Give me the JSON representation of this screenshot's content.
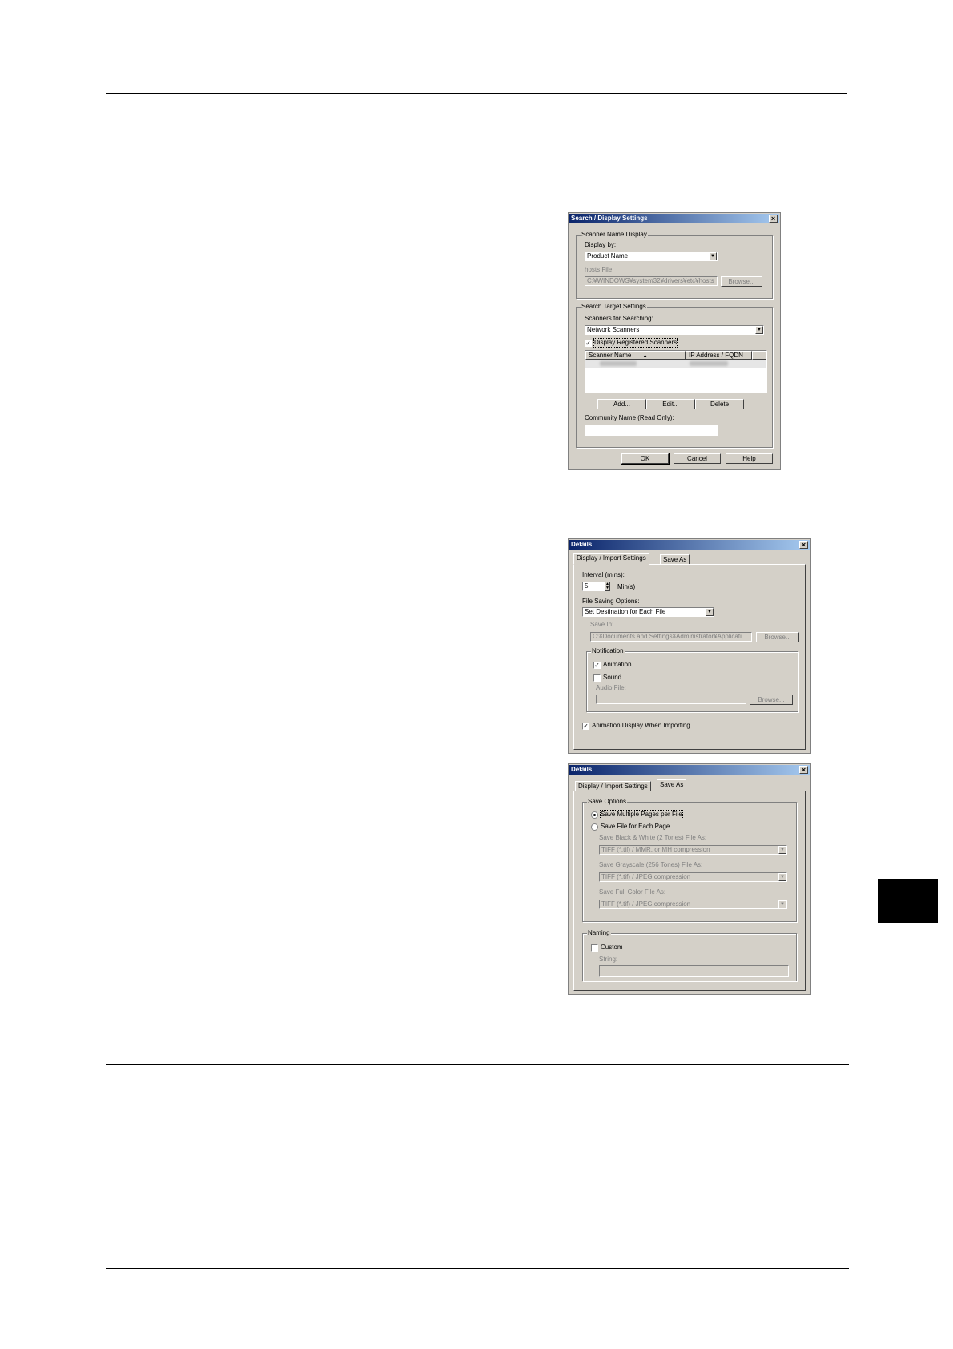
{
  "dialog1": {
    "title": "Search / Display Settings",
    "scanner_name_display": {
      "label": "Scanner Name Display",
      "display_by_label": "Display by:",
      "display_by_value": "Product Name",
      "hosts_file_label": "hosts File:",
      "hosts_file_value": "C:¥WINDOWS¥system32¥drivers¥etc¥hosts",
      "browse_label": "Browse..."
    },
    "search_target": {
      "label": "Search Target Settings",
      "scanners_label": "Scanners for Searching:",
      "scanners_value": "Network Scanners",
      "display_registered_label": "Display Registered Scanners",
      "display_registered_checked": true,
      "columns": [
        "Scanner Name",
        "IP Address / FQDN"
      ],
      "sort_glyph": "▲",
      "add_label": "Add...",
      "edit_label": "Edit...",
      "delete_label": "Delete",
      "community_label": "Community Name (Read Only):",
      "community_value": ""
    },
    "ok_label": "OK",
    "cancel_label": "Cancel",
    "help_label": "Help"
  },
  "dialog2": {
    "title": "Details",
    "tabs": [
      "Display / Import Settings",
      "Save As"
    ],
    "interval_label": "Interval (mins):",
    "interval_value": "5",
    "interval_unit": "Min(s)",
    "file_saving_label": "File Saving Options:",
    "file_saving_value": "Set Destination for Each File",
    "save_in_label": "Save In:",
    "save_in_value": "C:¥Documents and Settings¥Administrator¥Applicati",
    "browse_label": "Browse...",
    "notification_label": "Notification",
    "animation_label": "Animation",
    "animation_checked": true,
    "sound_label": "Sound",
    "sound_checked": false,
    "audio_file_label": "Audio File:",
    "audio_browse_label": "Browse...",
    "anim_display_label": "Animation Display When Importing",
    "anim_display_checked": true
  },
  "dialog3": {
    "title": "Details",
    "tabs": [
      "Display / Import Settings",
      "Save As"
    ],
    "save_options_label": "Save Options",
    "save_multi_label": "Save Multiple Pages per File",
    "save_each_label": "Save File for Each Page",
    "bw_label": "Save Black & White (2 Tones) File As:",
    "bw_value": "TIFF (*.tif) / MMR, or MH compression",
    "gray_label": "Save Grayscale (256 Tones) File As:",
    "gray_value": "TIFF (*.tif) / JPEG compression",
    "color_label": "Save Full Color File As:",
    "color_value": "TIFF (*.tif) / JPEG compression",
    "naming_label": "Naming",
    "custom_label": "Custom",
    "custom_checked": false,
    "string_label": "String:"
  },
  "icons": {
    "close": "×",
    "dropdown": "▼",
    "check": "✓"
  }
}
